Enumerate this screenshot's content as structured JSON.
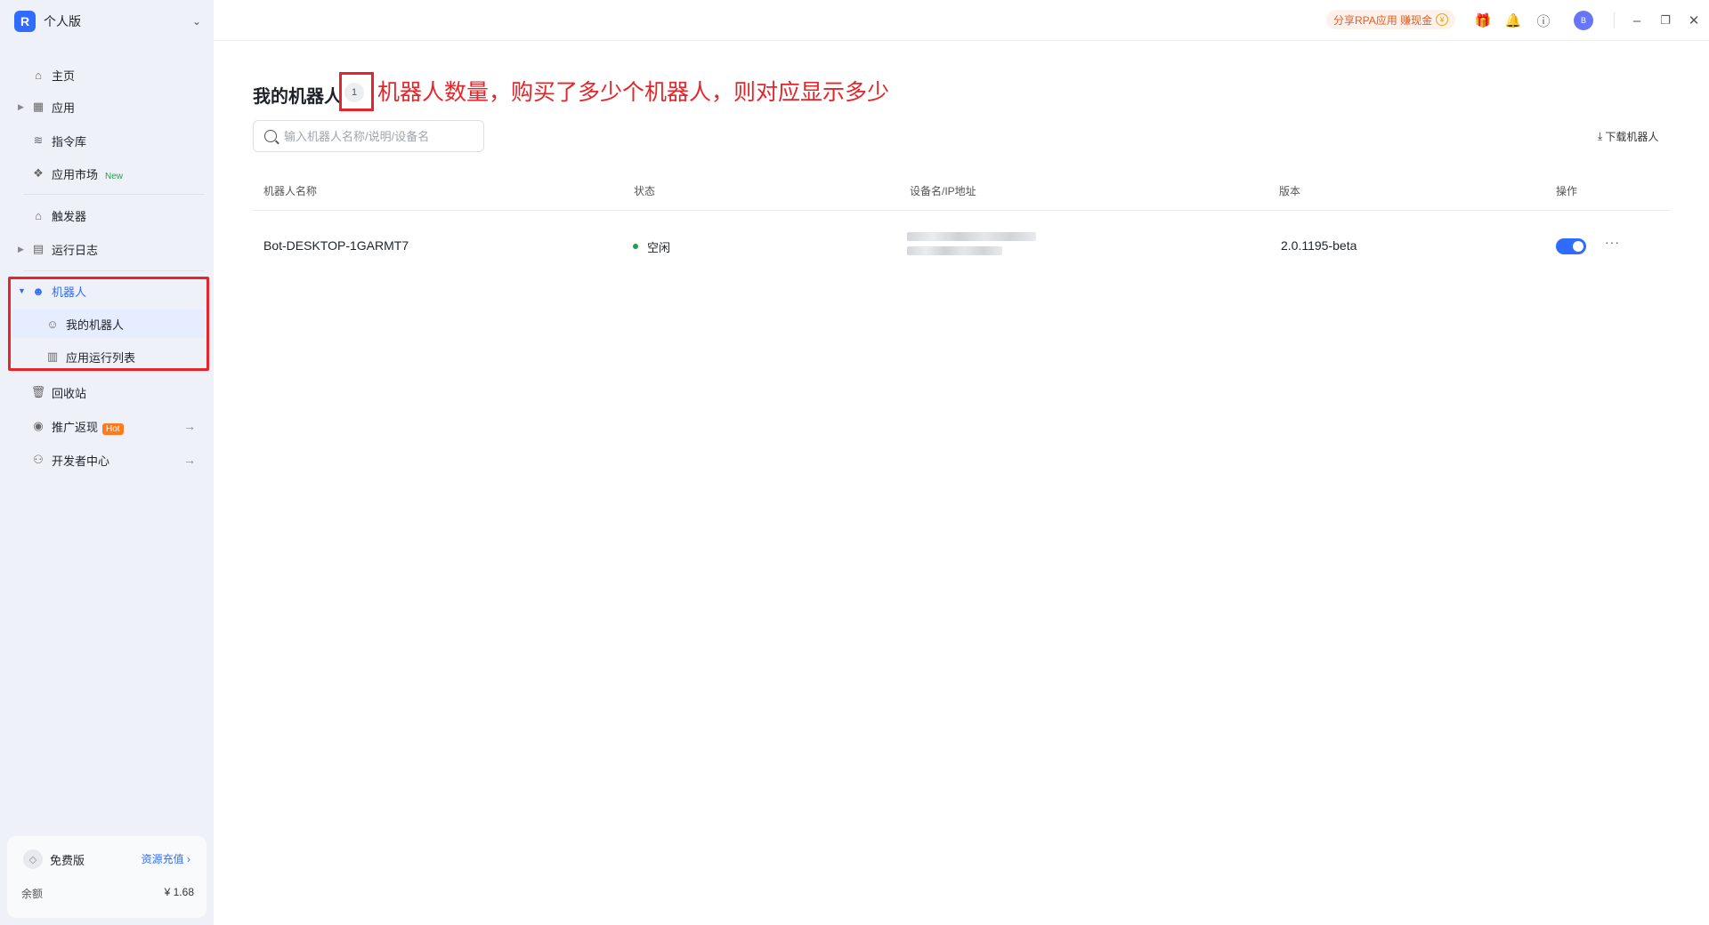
{
  "app": {
    "edition_label": "个人版",
    "logo_glyph": "R",
    "chevron": "⌄"
  },
  "sidebar": {
    "items": [
      {
        "label": "主页",
        "icon": "home-icon"
      },
      {
        "label": "应用",
        "icon": "apps-grid-icon"
      },
      {
        "label": "指令库",
        "icon": "layers-icon"
      },
      {
        "label": "应用市场",
        "icon": "market-icon",
        "badge": "New"
      },
      {
        "label": "触发器",
        "icon": "trigger-icon"
      },
      {
        "label": "运行日志",
        "icon": "log-icon"
      },
      {
        "label": "机器人",
        "icon": "robot-icon"
      },
      {
        "label": "我的机器人",
        "icon": "robot-outline-icon"
      },
      {
        "label": "应用运行列表",
        "icon": "run-list-icon"
      },
      {
        "label": "回收站",
        "icon": "trash-icon"
      },
      {
        "label": "推广返现",
        "icon": "cashback-icon",
        "badge": "Hot"
      },
      {
        "label": "开发者中心",
        "icon": "developer-icon"
      }
    ],
    "plan": {
      "name": "免费版",
      "recharge_label": "资源充值 ›",
      "balance_label": "余额",
      "balance_value": "¥ 1.68"
    }
  },
  "topbar": {
    "share_label": "分享RPA应用 赚现金",
    "coin_glyph": "¥",
    "avatar_initial": "B"
  },
  "main": {
    "title": "我的机器人",
    "robot_count": "1",
    "annotation": "机器人数量，购买了多少个机器人，则对应显示多少",
    "search_placeholder": "输入机器人名称/说明/设备名",
    "download_label": "下载机器人",
    "columns": [
      "机器人名称",
      "状态",
      "设备名/IP地址",
      "版本",
      "操作"
    ],
    "rows": [
      {
        "name": "Bot-DESKTOP-1GARMT7",
        "status": "空闲",
        "version": "2.0.1195-beta",
        "enabled": true
      }
    ]
  },
  "colors": {
    "accent": "#2f6bff",
    "annotation_red": "#e5252a",
    "status_green": "#23a04a",
    "hot_orange": "#ff7a1a",
    "sidebar_bg": "#eef1f8"
  }
}
